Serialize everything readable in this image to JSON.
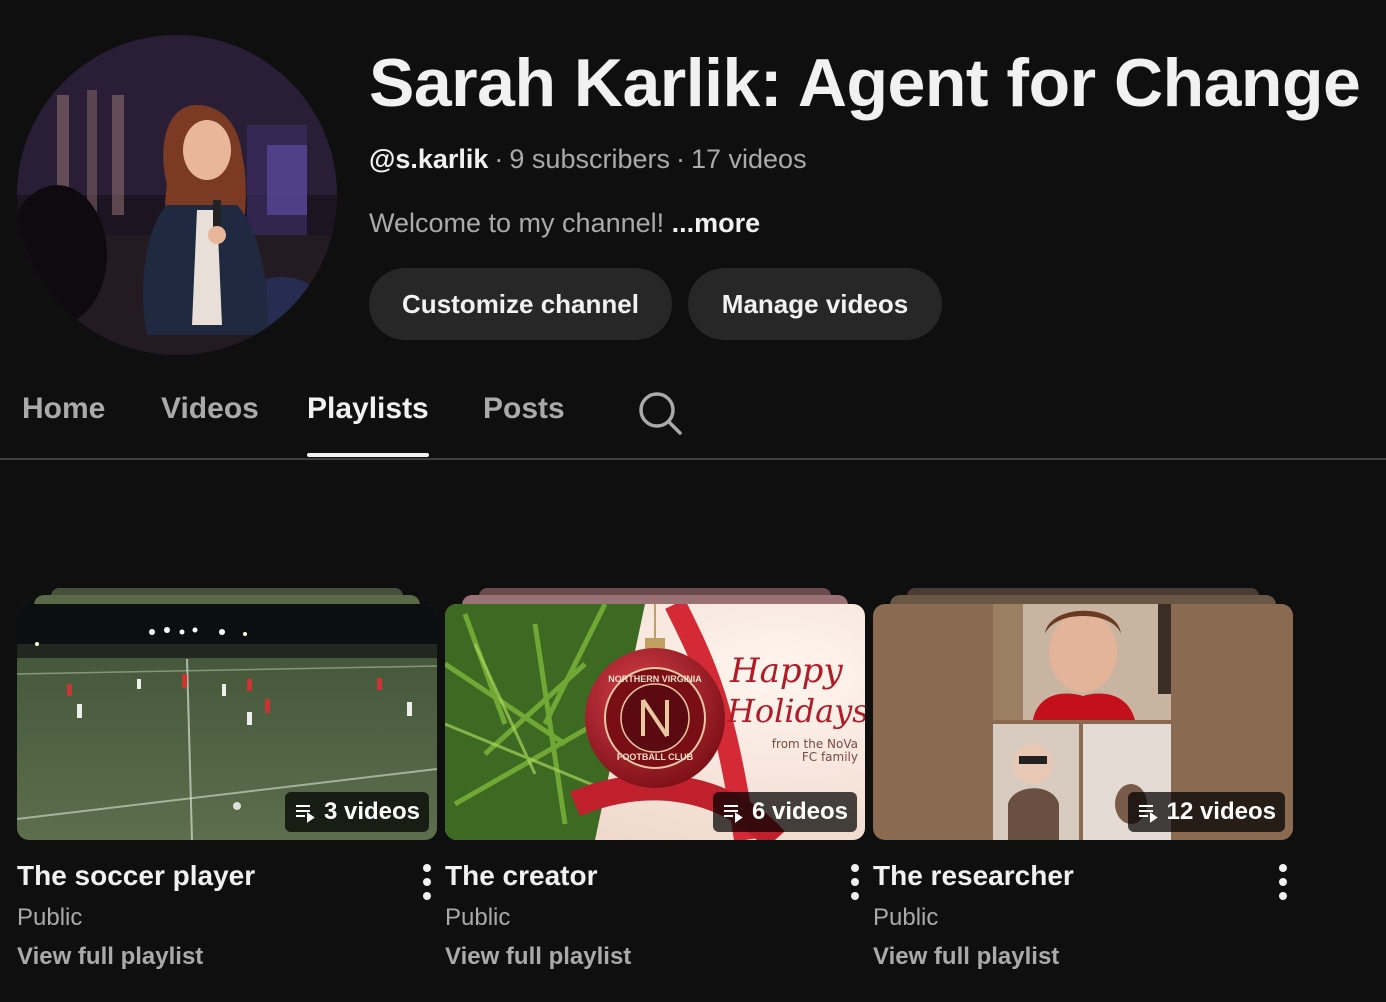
{
  "channel": {
    "title": "Sarah Karlik: Agent for Change",
    "handle": "@s.karlik",
    "subscribers": "9 subscribers",
    "videos": "17 videos",
    "separator": "·",
    "description": "Welcome to my channel!",
    "more_label": "...more"
  },
  "actions": {
    "customize_label": "Customize channel",
    "manage_label": "Manage videos"
  },
  "tabs": [
    {
      "label": "Home",
      "active": false
    },
    {
      "label": "Videos",
      "active": false
    },
    {
      "label": "Playlists",
      "active": true
    },
    {
      "label": "Posts",
      "active": false
    }
  ],
  "playlists": [
    {
      "title": "The soccer player",
      "visibility": "Public",
      "link": "View full playlist",
      "count": "3 videos"
    },
    {
      "title": "The creator",
      "visibility": "Public",
      "link": "View full playlist",
      "count": "6 videos",
      "thumb_text": {
        "line1": "Happy",
        "line2": "Holidays",
        "line3": "from the NoVa",
        "line4": "FC family",
        "badge_top": "NORTHERN VIRGINIA",
        "badge_bottom": "FOOTBALL CLUB"
      }
    },
    {
      "title": "The researcher",
      "visibility": "Public",
      "link": "View full playlist",
      "count": "12 videos"
    }
  ],
  "icons": {
    "search": "search-icon",
    "playlist": "playlist-icon",
    "more": "more-vert-icon"
  },
  "colors": {
    "background": "#0f0f0f",
    "text": "#f1f1f1",
    "muted": "#aaaaaa",
    "button_bg": "#272727"
  }
}
